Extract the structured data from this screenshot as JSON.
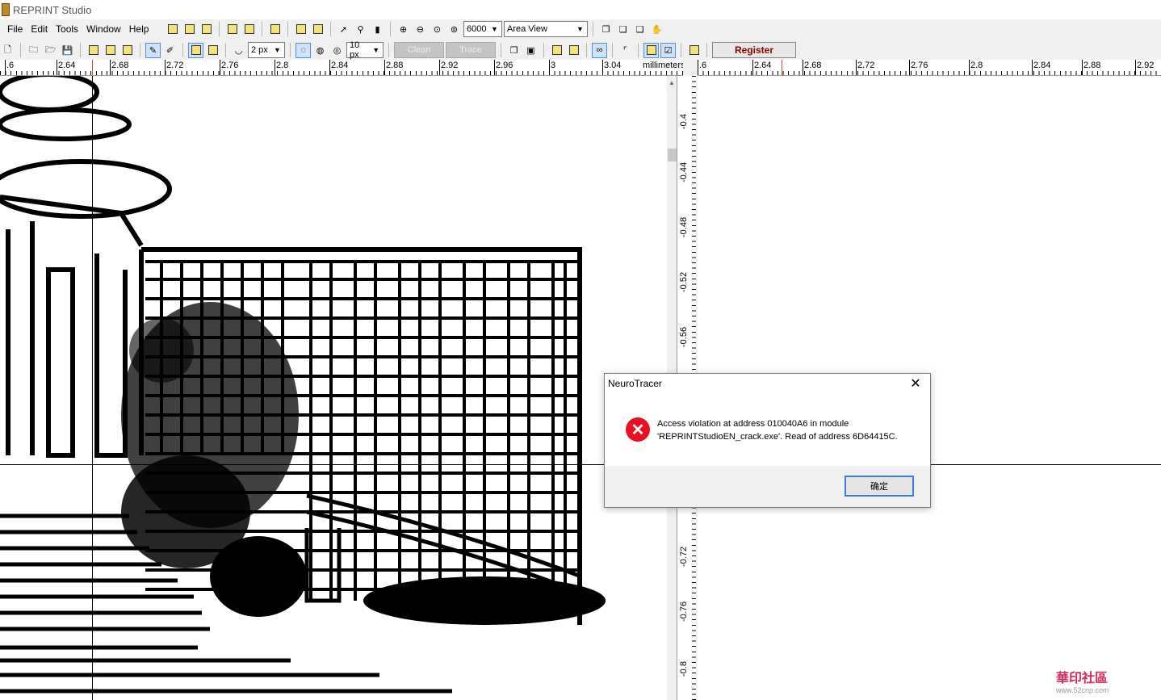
{
  "window": {
    "title": "REPRINT Studio"
  },
  "menu": [
    "File",
    "Edit",
    "Tools",
    "Window",
    "Help"
  ],
  "toolbar": {
    "zoom_value": "6000",
    "view_mode": "Area View",
    "line_width": "2 px",
    "tolerance": "10 px",
    "clean_label": "Clean",
    "trace_label": "Trace",
    "register_label": "Register"
  },
  "ruler": {
    "unit": "millimeters",
    "left_labels": [
      ".6",
      "2.64",
      "2.68",
      "2.72",
      "2.76",
      "2.8",
      "2.84",
      "2.88",
      "2.92",
      "2.96",
      "3",
      "3.04"
    ],
    "right_labels": [
      ".6",
      "2.64",
      "2.68",
      "2.72",
      "2.76",
      "2.8",
      "2.84",
      "2.88",
      "2.92"
    ],
    "vertical_labels": [
      "-0.4",
      "-0.44",
      "-0.48",
      "-0.52",
      "-0.56",
      "-0.72",
      "-0.76",
      "-0.8"
    ]
  },
  "dialog": {
    "title": "NeuroTracer",
    "message_line1": "Access violation at address 010040A6 in module",
    "message_line2": "'REPRINTStudioEN_crack.exe'. Read of address 6D64415C.",
    "ok_label": "确定"
  },
  "watermark": {
    "text": "華印社區",
    "url": "www.52cnp.com"
  }
}
